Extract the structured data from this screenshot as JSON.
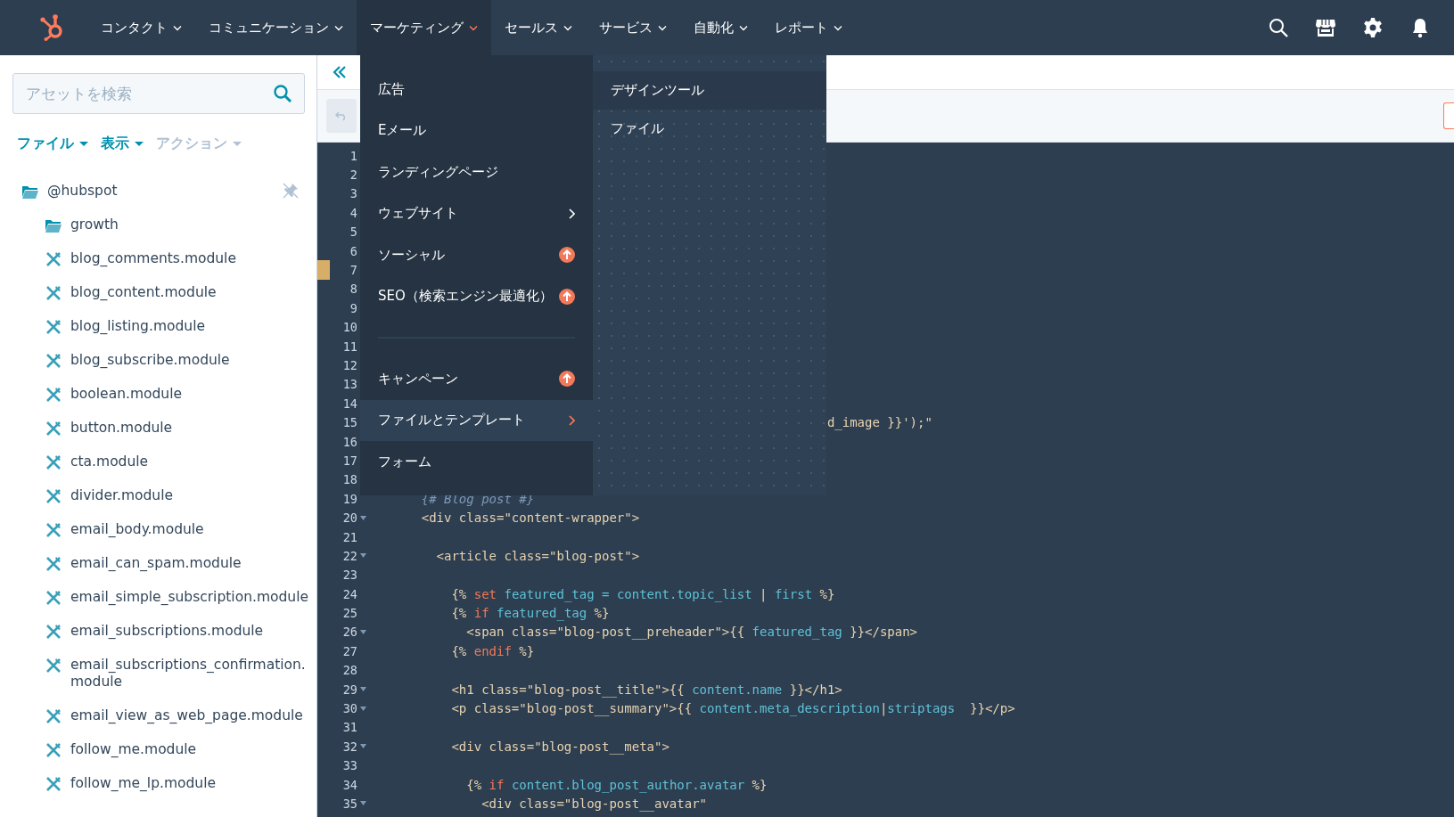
{
  "top_nav": {
    "items": [
      {
        "label": "コンタクト",
        "selected": false
      },
      {
        "label": "コミュニケーション",
        "selected": false
      },
      {
        "label": "マーケティング",
        "selected": true
      },
      {
        "label": "セールス",
        "selected": false
      },
      {
        "label": "サービス",
        "selected": false
      },
      {
        "label": "自動化",
        "selected": false
      },
      {
        "label": "レポート",
        "selected": false
      }
    ]
  },
  "sidebar": {
    "search": {
      "placeholder": "アセットを検索"
    },
    "menus": [
      {
        "label": "ファイル",
        "disabled": false
      },
      {
        "label": "表示",
        "disabled": false
      },
      {
        "label": "アクション",
        "disabled": true
      }
    ],
    "tree": [
      {
        "label": "@hubspot",
        "kind": "folder",
        "children": [
          {
            "label": "growth",
            "kind": "folder"
          },
          {
            "label": "blog_comments.module",
            "kind": "module"
          },
          {
            "label": "blog_content.module",
            "kind": "module"
          },
          {
            "label": "blog_listing.module",
            "kind": "module"
          },
          {
            "label": "blog_subscribe.module",
            "kind": "module"
          },
          {
            "label": "boolean.module",
            "kind": "module"
          },
          {
            "label": "button.module",
            "kind": "module"
          },
          {
            "label": "cta.module",
            "kind": "module"
          },
          {
            "label": "divider.module",
            "kind": "module"
          },
          {
            "label": "email_body.module",
            "kind": "module"
          },
          {
            "label": "email_can_spam.module",
            "kind": "module"
          },
          {
            "label": "email_simple_subscription.module",
            "kind": "module"
          },
          {
            "label": "email_subscriptions.module",
            "kind": "module"
          },
          {
            "label": "email_subscriptions_confirmation.module",
            "kind": "module"
          },
          {
            "label": "email_view_as_web_page.module",
            "kind": "module"
          },
          {
            "label": "follow_me.module",
            "kind": "module"
          },
          {
            "label": "follow_me_lp.module",
            "kind": "module"
          }
        ]
      }
    ]
  },
  "marketing_menu": {
    "items": [
      {
        "label": "広告",
        "kind": "item",
        "submenu": false,
        "upgrade": false,
        "selected": false
      },
      {
        "label": "Eメール",
        "kind": "item",
        "submenu": false,
        "upgrade": false,
        "selected": false
      },
      {
        "label": "ランディングページ",
        "kind": "item",
        "submenu": false,
        "upgrade": false,
        "selected": false
      },
      {
        "label": "ウェブサイト",
        "kind": "item",
        "submenu": true,
        "upgrade": false,
        "selected": false
      },
      {
        "label": "ソーシャル",
        "kind": "item",
        "submenu": false,
        "upgrade": true,
        "selected": false
      },
      {
        "label": "SEO（検索エンジン最適化）",
        "kind": "item",
        "submenu": false,
        "upgrade": true,
        "selected": false
      },
      {
        "kind": "divider"
      },
      {
        "label": "キャンペーン",
        "kind": "item",
        "submenu": false,
        "upgrade": true,
        "selected": false
      },
      {
        "label": "ファイルとテンプレート",
        "kind": "item",
        "submenu": true,
        "upgrade": false,
        "selected": true
      },
      {
        "label": "フォーム",
        "kind": "item",
        "submenu": false,
        "upgrade": false,
        "selected": false
      }
    ],
    "submenu": [
      {
        "label": "デザインツール",
        "selected": true
      },
      {
        "label": "ファイル",
        "selected": false
      }
    ]
  },
  "editor": {
    "lines": [
      {
        "number": "1",
        "fold": false,
        "marked": false
      },
      {
        "number": "2",
        "fold": false,
        "marked": false
      },
      {
        "number": "3",
        "fold": false,
        "marked": false
      },
      {
        "number": "4",
        "fold": false,
        "marked": false
      },
      {
        "number": "5",
        "fold": false,
        "marked": false
      },
      {
        "number": "6",
        "fold": false,
        "marked": false
      },
      {
        "number": "7",
        "fold": false,
        "marked": true
      },
      {
        "number": "8",
        "fold": false,
        "marked": false
      },
      {
        "number": "9",
        "fold": false,
        "marked": false
      },
      {
        "number": "10",
        "fold": false,
        "marked": false
      },
      {
        "number": "11",
        "fold": false,
        "marked": false
      },
      {
        "number": "12",
        "fold": false,
        "marked": false
      },
      {
        "number": "13",
        "fold": false,
        "marked": false
      },
      {
        "number": "14",
        "fold": false,
        "marked": false
      },
      {
        "number": "15",
        "fold": false,
        "marked": false,
        "tokens": [
          {
            "text": "                                                          d_image }}');\"",
            "kind": "tag"
          }
        ]
      },
      {
        "number": "16",
        "fold": false,
        "marked": false
      },
      {
        "number": "17",
        "fold": false,
        "marked": false
      },
      {
        "number": "18",
        "fold": false,
        "marked": false
      },
      {
        "number": "19",
        "fold": false,
        "marked": false,
        "tokens": [
          {
            "text": "    {# Blog post #}",
            "kind": "comment"
          }
        ]
      },
      {
        "number": "20",
        "fold": true,
        "marked": false,
        "tokens": [
          {
            "text": "    <div class=\"content-wrapper\">",
            "kind": "tag"
          }
        ]
      },
      {
        "number": "21",
        "fold": false,
        "marked": false
      },
      {
        "number": "22",
        "fold": true,
        "marked": false,
        "tokens": [
          {
            "text": "      <article class=\"blog-post\">",
            "kind": "tag"
          }
        ]
      },
      {
        "number": "23",
        "fold": false,
        "marked": false
      },
      {
        "number": "24",
        "fold": false,
        "marked": false,
        "tokens": [
          {
            "text": "        {% ",
            "kind": "tag"
          },
          {
            "text": "set",
            "kind": "keyword"
          },
          {
            "text": " featured_tag = content.topic_list ",
            "kind": "var"
          },
          {
            "text": "|",
            "kind": "tag"
          },
          {
            "text": " first ",
            "kind": "var"
          },
          {
            "text": "%}",
            "kind": "tag"
          }
        ]
      },
      {
        "number": "25",
        "fold": false,
        "marked": false,
        "tokens": [
          {
            "text": "        {% ",
            "kind": "tag"
          },
          {
            "text": "if",
            "kind": "keyword"
          },
          {
            "text": " featured_tag ",
            "kind": "var"
          },
          {
            "text": "%}",
            "kind": "tag"
          }
        ]
      },
      {
        "number": "26",
        "fold": true,
        "marked": false,
        "tokens": [
          {
            "text": "          <span class=\"blog-post__preheader\">{{ ",
            "kind": "tag"
          },
          {
            "text": "featured_tag",
            "kind": "var"
          },
          {
            "text": " }}</span>",
            "kind": "tag"
          }
        ]
      },
      {
        "number": "27",
        "fold": false,
        "marked": false,
        "tokens": [
          {
            "text": "        {% ",
            "kind": "tag"
          },
          {
            "text": "endif",
            "kind": "keyword"
          },
          {
            "text": " %}",
            "kind": "tag"
          }
        ]
      },
      {
        "number": "28",
        "fold": false,
        "marked": false
      },
      {
        "number": "29",
        "fold": true,
        "marked": false,
        "tokens": [
          {
            "text": "        <h1 class=\"blog-post__title\">{{ ",
            "kind": "tag"
          },
          {
            "text": "content.name",
            "kind": "var"
          },
          {
            "text": " }}</h1>",
            "kind": "tag"
          }
        ]
      },
      {
        "number": "30",
        "fold": true,
        "marked": false,
        "tokens": [
          {
            "text": "        <p class=\"blog-post__summary\">{{ ",
            "kind": "tag"
          },
          {
            "text": "content.meta_description",
            "kind": "var"
          },
          {
            "text": "|",
            "kind": "tag"
          },
          {
            "text": "striptags",
            "kind": "var"
          },
          {
            "text": "  }}</p>",
            "kind": "tag"
          }
        ]
      },
      {
        "number": "31",
        "fold": false,
        "marked": false
      },
      {
        "number": "32",
        "fold": true,
        "marked": false,
        "tokens": [
          {
            "text": "        <div class=\"blog-post__meta\">",
            "kind": "tag"
          }
        ]
      },
      {
        "number": "33",
        "fold": false,
        "marked": false
      },
      {
        "number": "34",
        "fold": false,
        "marked": false,
        "tokens": [
          {
            "text": "          {% ",
            "kind": "tag"
          },
          {
            "text": "if",
            "kind": "keyword"
          },
          {
            "text": " content.blog_post_author.avatar ",
            "kind": "var"
          },
          {
            "text": "%}",
            "kind": "tag"
          }
        ]
      },
      {
        "number": "35",
        "fold": true,
        "marked": false,
        "tokens": [
          {
            "text": "            <div class=\"blog-post__avatar\"",
            "kind": "tag"
          }
        ]
      }
    ]
  }
}
